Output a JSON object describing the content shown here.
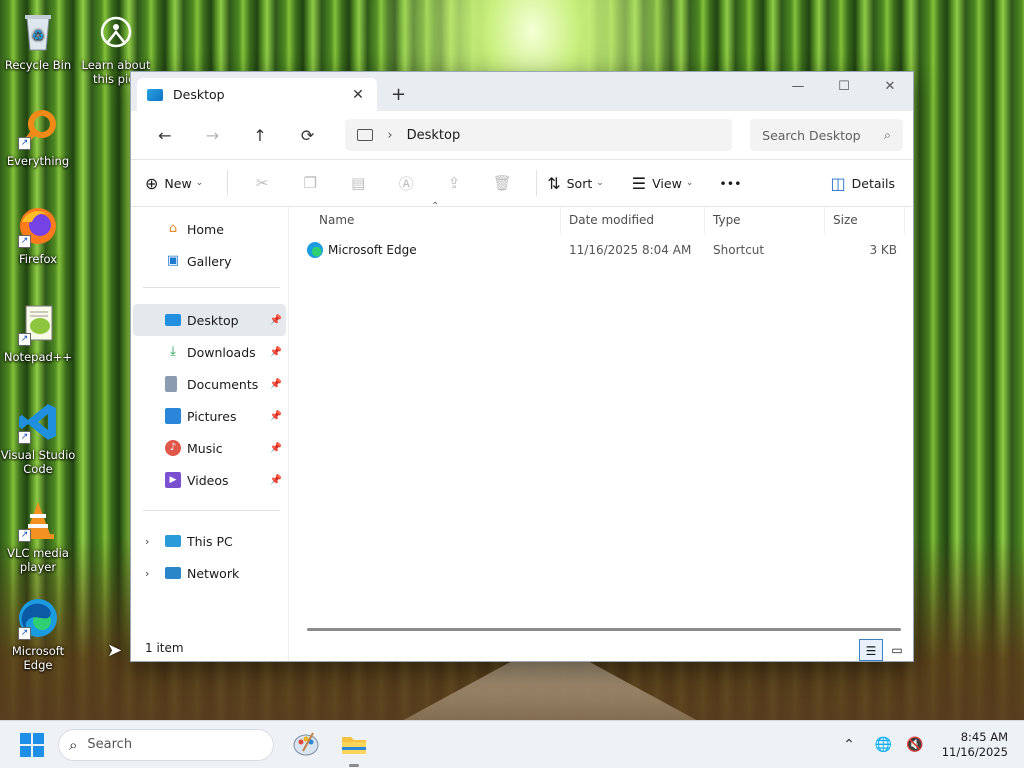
{
  "desktop": {
    "icons": [
      {
        "label": "Recycle Bin"
      },
      {
        "label": "Learn about this pict"
      },
      {
        "label": "Everything"
      },
      {
        "label": "Firefox"
      },
      {
        "label": "Notepad++"
      },
      {
        "label": "Visual Studio Code"
      },
      {
        "label": "VLC media player"
      },
      {
        "label": "Microsoft Edge"
      }
    ]
  },
  "window": {
    "tab_title": "Desktop",
    "tab_close": "✕",
    "new_tab": "+",
    "controls": {
      "minimize": "—",
      "maximize": "☐",
      "close": "✕"
    },
    "nav": {
      "back": "←",
      "forward": "→",
      "up": "↑",
      "refresh": "⟳"
    },
    "breadcrumb": {
      "separator": "›",
      "current": "Desktop"
    },
    "search": {
      "placeholder": "Search Desktop",
      "icon": "⌕"
    },
    "toolbar": {
      "new_label": "New",
      "sort_label": "Sort",
      "view_label": "View",
      "more_label": "•••",
      "details_label": "Details"
    },
    "sidebar": {
      "top": [
        {
          "label": "Home",
          "icon": "⌂",
          "color": "#e08a2c"
        },
        {
          "label": "Gallery",
          "icon": "▣",
          "color": "#1f7bd0"
        }
      ],
      "quick": [
        {
          "label": "Desktop",
          "color": "#1f8fde",
          "selected": true
        },
        {
          "label": "Downloads",
          "color": "#1a9a4a"
        },
        {
          "label": "Documents",
          "color": "#6a7a90"
        },
        {
          "label": "Pictures",
          "color": "#2a86d8"
        },
        {
          "label": "Music",
          "color": "#e0584a"
        },
        {
          "label": "Videos",
          "color": "#7a4fd0"
        }
      ],
      "bottom": [
        {
          "label": "This PC",
          "color": "#2a9ad8"
        },
        {
          "label": "Network",
          "color": "#2a86c8"
        }
      ]
    },
    "columns": [
      "Name",
      "Date modified",
      "Type",
      "Size"
    ],
    "files": [
      {
        "name": "Microsoft Edge",
        "date": "11/16/2025 8:04 AM",
        "type": "Shortcut",
        "size": "3 KB"
      }
    ],
    "status": "1 item"
  },
  "taskbar": {
    "search_placeholder": "Search",
    "time": "8:45 AM",
    "date": "11/16/2025"
  }
}
